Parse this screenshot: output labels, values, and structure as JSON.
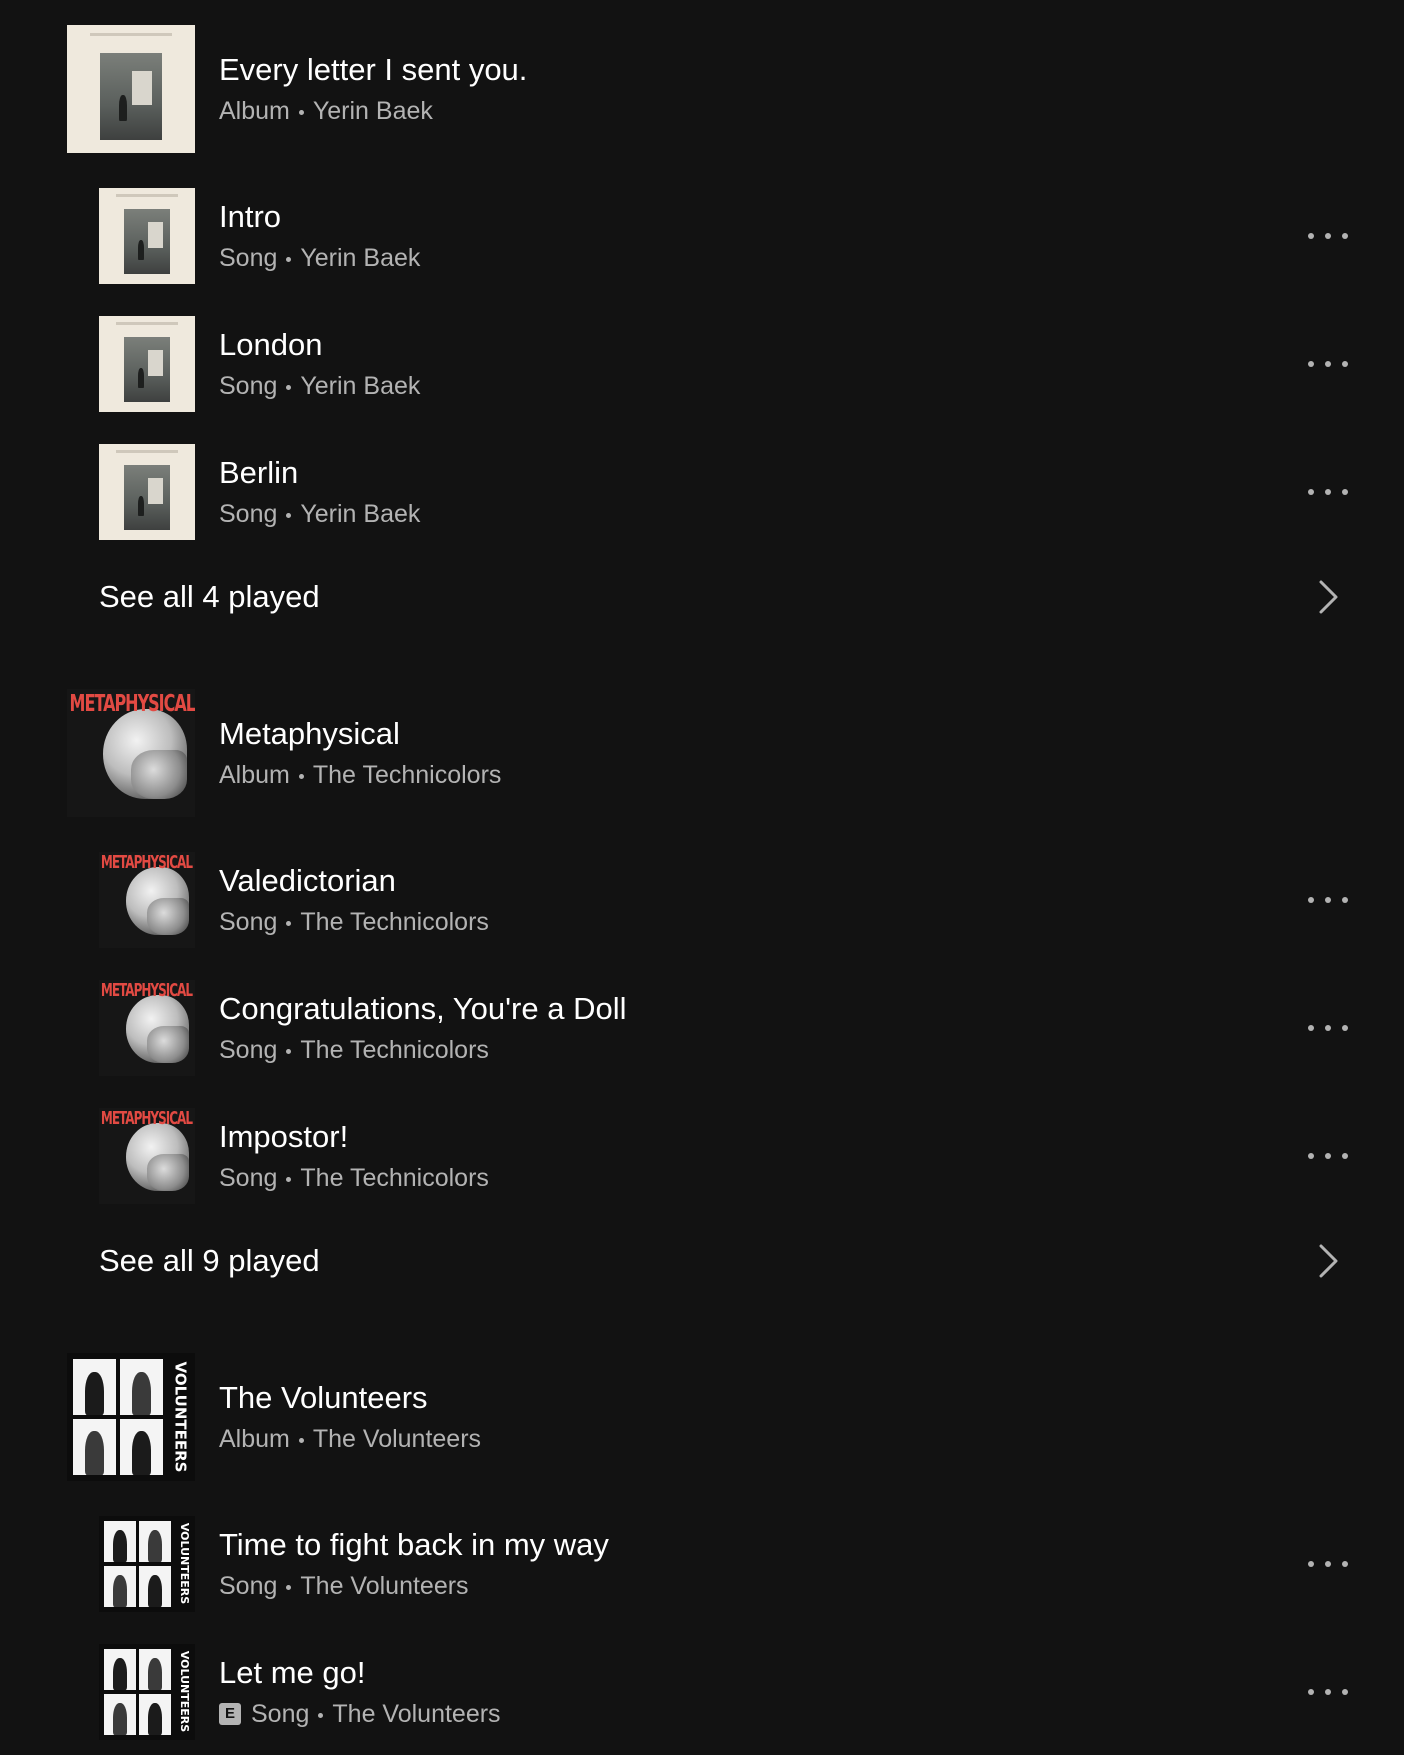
{
  "groups": [
    {
      "album": {
        "title": "Every letter I sent you.",
        "type": "Album",
        "artist": "Yerin Baek",
        "art": "yerin"
      },
      "songs": [
        {
          "title": "Intro",
          "type": "Song",
          "artist": "Yerin Baek",
          "explicit": false
        },
        {
          "title": "London",
          "type": "Song",
          "artist": "Yerin Baek",
          "explicit": false
        },
        {
          "title": "Berlin",
          "type": "Song",
          "artist": "Yerin Baek",
          "explicit": false
        }
      ],
      "see_all": "See all 4 played"
    },
    {
      "album": {
        "title": "Metaphysical",
        "type": "Album",
        "artist": "The Technicolors",
        "art": "metaphysical",
        "art_text": "METAPHYSICAL"
      },
      "songs": [
        {
          "title": "Valedictorian",
          "type": "Song",
          "artist": "The Technicolors",
          "explicit": false
        },
        {
          "title": "Congratulations, You're a Doll",
          "type": "Song",
          "artist": "The Technicolors",
          "explicit": false
        },
        {
          "title": "Impostor!",
          "type": "Song",
          "artist": "The Technicolors",
          "explicit": false
        }
      ],
      "see_all": "See all 9 played"
    },
    {
      "album": {
        "title": "The Volunteers",
        "type": "Album",
        "artist": "The Volunteers",
        "art": "volunteers",
        "art_text": "VOLUNTEERS"
      },
      "songs": [
        {
          "title": "Time to fight back in my way",
          "type": "Song",
          "artist": "The Volunteers",
          "explicit": false
        },
        {
          "title": "Let me go!",
          "type": "Song",
          "artist": "The Volunteers",
          "explicit": true,
          "explicit_label": "E"
        }
      ]
    }
  ],
  "icons": {
    "more": "more-options-icon",
    "chevron": "chevron-right-icon"
  },
  "colors": {
    "background": "#121212",
    "primary_text": "#ffffff",
    "secondary_text": "#b3b3b3"
  }
}
